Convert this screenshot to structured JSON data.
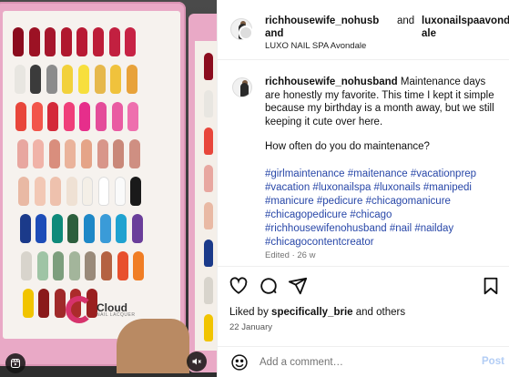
{
  "header": {
    "username1": "richhousewife_nohusb",
    "and_word": "and",
    "username2": "luxonailspaavond",
    "username1_end": "and",
    "username2_end": "ale",
    "location": "LUXO NAIL SPA Avondale"
  },
  "media": {
    "logo_text": "Cloud",
    "logo_subtext": "NAIL LACQUER",
    "colors": {
      "row1": [
        "#8b0c1e",
        "#9c1224",
        "#a6162c",
        "#b0182e",
        "#b81a34",
        "#bd1d38",
        "#c22040",
        "#c72345"
      ],
      "row2": [
        "#e8e6e1",
        "#3b3b3b",
        "#8c8c8c",
        "#f2d13b",
        "#f7df3d",
        "#e6b84c",
        "#f0c23c",
        "#e8a23a"
      ],
      "row3": [
        "#e8463b",
        "#f2554a",
        "#d42a3a",
        "#ef3f7a",
        "#e62e8b",
        "#e44c9a",
        "#e95ba2",
        "#ee6fae"
      ],
      "row4": [
        "#e8a7a0",
        "#f0b3a8",
        "#d98e7d",
        "#eab39b",
        "#e5a488",
        "#d8968a",
        "#c98879",
        "#cf8f82"
      ],
      "row5": [
        "#e9b9a4",
        "#f2c8b5",
        "#eec1ad",
        "#efe1d4",
        "#f4efe7",
        "#ffffff",
        "#fafafa",
        "#1a1a1a"
      ],
      "row6": [
        "#1b3a8a",
        "#1e4db8",
        "#0f8a7a",
        "#2d5f3d",
        "#1e88c7",
        "#3a9bd8",
        "#1fa2d0",
        "#6a3e9a"
      ],
      "row7": [
        "#d8d4cc",
        "#9fc4a5",
        "#7d9e7d",
        "#a3b59b",
        "#9a8a7a",
        "#b46242",
        "#e8502e",
        "#f07d24"
      ],
      "row8": [
        "#f1c400",
        "#8a1a1a",
        "#a02a2a",
        "#ac2b2b",
        "#9a2020"
      ]
    }
  },
  "caption": {
    "username": "richhousewife_nohusband",
    "text": "Maintenance days are honestly my favorite. This time I kept it simple because my birthday is a month away, but we still keeping it cute over here.",
    "question": "How often do you do maintenance?",
    "hashtags": "#girlmaintenance #maitenance #vacationprep #vacation #luxonailspa #luxonails #manipedi #manicure #pedicure #chicagomanicure #chicagopedicure #chicago #richhousewifenohusband #nail #nailday #chicagocontentcreator",
    "edited": "Edited · 26 w"
  },
  "actions": {
    "likes_prefix": "Liked by",
    "likes_user": "specifically_brie",
    "likes_suffix": "and others",
    "date": "22 January"
  },
  "comment": {
    "placeholder": "Add a comment…",
    "post_label": "Post"
  },
  "icons": [
    "heart-icon",
    "comment-icon",
    "share-icon",
    "bookmark-icon",
    "emoji-icon",
    "mute-icon",
    "reels-icon"
  ]
}
